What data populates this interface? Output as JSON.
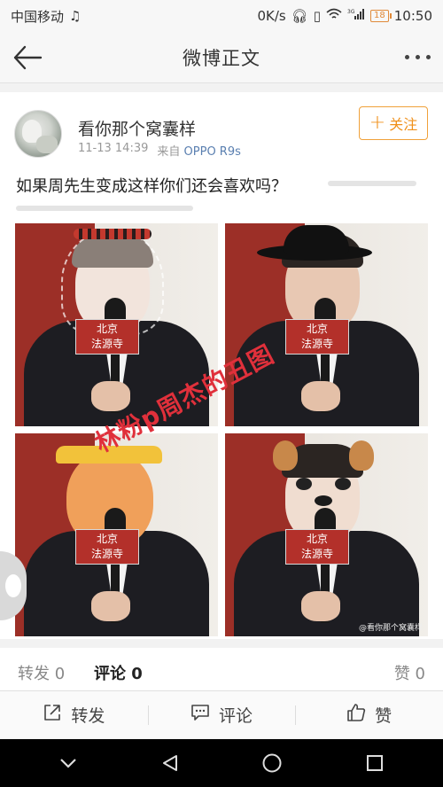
{
  "status_bar": {
    "carrier": "中国移动",
    "music_icon": "music-note-icon",
    "speed": "0K/s",
    "signal_label": "3G",
    "battery": "18",
    "time": "10:50"
  },
  "nav": {
    "title": "微博正文",
    "back_icon": "arrow-left-icon",
    "more_icon": "more-dots-icon"
  },
  "post": {
    "username": "看你那个窝囊样",
    "time": "11-13 14:39",
    "source_prefix": "来自",
    "device": "OPPO R9s",
    "follow_label": "关注",
    "text": "如果周先生变成这样你们还会喜欢吗？",
    "photo_sign_text": "北京\n法源寺",
    "watermark": "@看你那个窝囊样",
    "overlay_text": "林粉p周杰的丑图"
  },
  "stats": {
    "repost": "转发 0",
    "comment": "评论 0",
    "like": "赞 0"
  },
  "actions": {
    "repost": "转发",
    "comment": "评论",
    "like": "赞"
  },
  "colors": {
    "accent": "#f0901a",
    "device_link": "#5a7fb0",
    "overlay_red": "#e0303b"
  }
}
